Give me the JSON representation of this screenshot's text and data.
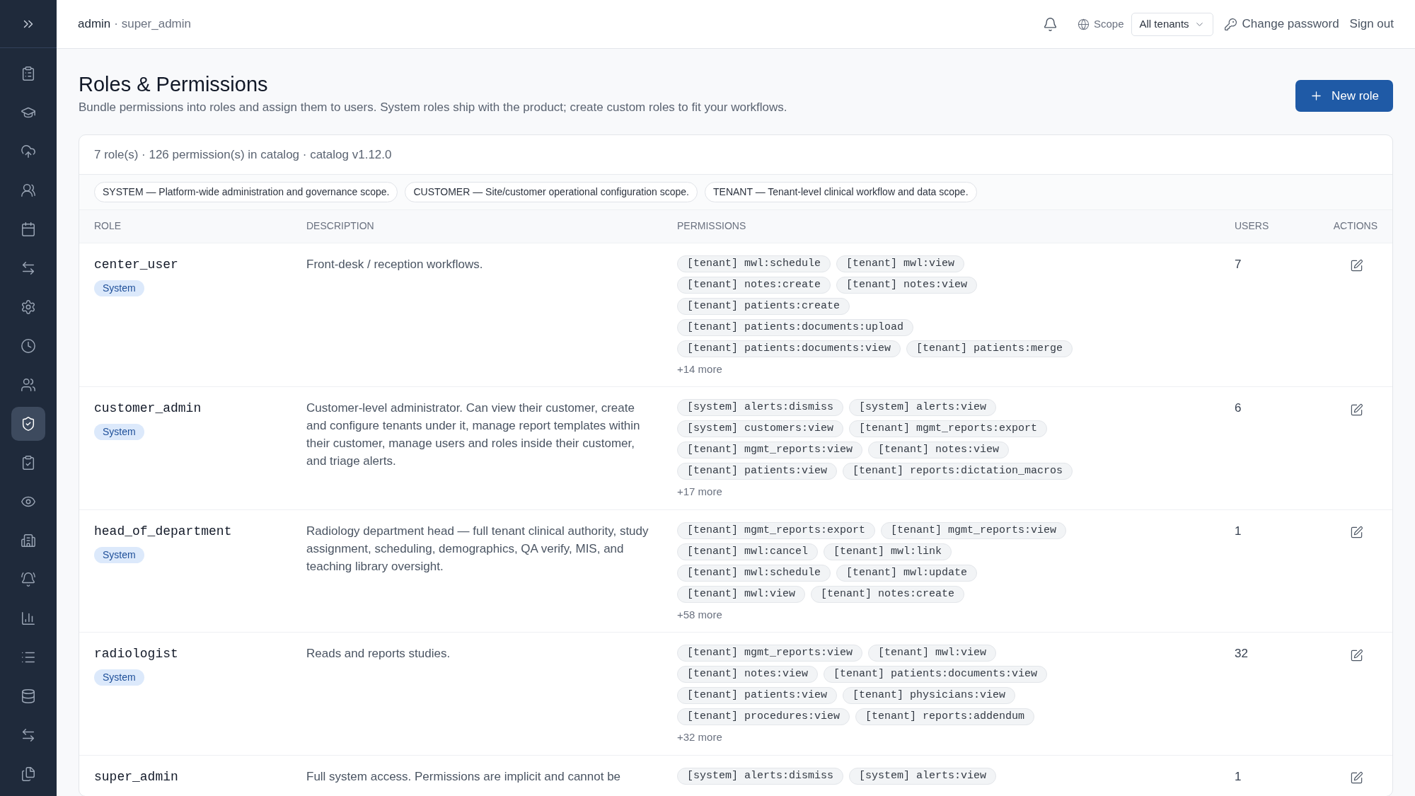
{
  "header": {
    "user": "admin",
    "role": "· super_admin",
    "scope_label": "Scope",
    "scope_value": "All tenants",
    "change_password": "Change password",
    "sign_out": "Sign out"
  },
  "sidebar": {
    "items": [
      {
        "selected": false
      },
      {
        "selected": false
      },
      {
        "selected": false
      },
      {
        "selected": false
      },
      {
        "selected": false
      },
      {
        "selected": false
      },
      {
        "selected": false
      },
      {
        "selected": false
      },
      {
        "selected": false
      },
      {
        "selected": true
      },
      {
        "selected": false
      },
      {
        "selected": false
      },
      {
        "selected": false
      },
      {
        "selected": false
      },
      {
        "selected": false
      },
      {
        "selected": false
      },
      {
        "selected": false
      },
      {
        "selected": false
      },
      {
        "selected": false
      }
    ]
  },
  "page": {
    "title": "Roles & Permissions",
    "subtitle": "Bundle permissions into roles and assign them to users. System roles ship with the product; create custom roles to fit your workflows.",
    "new_button": "New role"
  },
  "summary": "7 role(s) · 126 permission(s) in catalog · catalog v1.12.0",
  "scopes": [
    "SYSTEM — Platform-wide administration and governance scope.",
    "CUSTOMER — Site/customer operational configuration scope.",
    "TENANT — Tenant-level clinical workflow and data scope."
  ],
  "table": {
    "columns": [
      "ROLE",
      "DESCRIPTION",
      "PERMISSIONS",
      "USERS",
      "ACTIONS"
    ],
    "rows": [
      {
        "name": "center_user",
        "badge": "System",
        "description": "Front-desk / reception workflows.",
        "permission_lines": [
          [
            "[tenant] mwl:schedule",
            "[tenant] mwl:view"
          ],
          [
            "[tenant] notes:create",
            "[tenant] notes:view"
          ],
          [
            "[tenant] patients:create"
          ],
          [
            "[tenant] patients:documents:upload"
          ],
          [
            "[tenant] patients:documents:view",
            "[tenant] patients:merge"
          ]
        ],
        "more": "+14 more",
        "users": "7"
      },
      {
        "name": "customer_admin",
        "badge": "System",
        "description": "Customer-level administrator. Can view their customer, create and configure tenants under it, manage report templates within their customer, manage users and roles inside their customer, and triage alerts.",
        "permission_lines": [
          [
            "[system] alerts:dismiss",
            "[system] alerts:view"
          ],
          [
            "[system] customers:view",
            "[tenant] mgmt_reports:export"
          ],
          [
            "[tenant] mgmt_reports:view",
            "[tenant] notes:view"
          ],
          [
            "[tenant] patients:view",
            "[tenant] reports:dictation_macros"
          ]
        ],
        "more": "+17 more",
        "users": "6"
      },
      {
        "name": "head_of_department",
        "badge": "System",
        "description": "Radiology department head — full tenant clinical authority, study assignment, scheduling, demographics, QA verify, MIS, and teaching library oversight.",
        "permission_lines": [
          [
            "[tenant] mgmt_reports:export",
            "[tenant] mgmt_reports:view"
          ],
          [
            "[tenant] mwl:cancel",
            "[tenant] mwl:link"
          ],
          [
            "[tenant] mwl:schedule",
            "[tenant] mwl:update"
          ],
          [
            "[tenant] mwl:view",
            "[tenant] notes:create"
          ]
        ],
        "more": "+58 more",
        "users": "1"
      },
      {
        "name": "radiologist",
        "badge": "System",
        "description": "Reads and reports studies.",
        "permission_lines": [
          [
            "[tenant] mgmt_reports:view",
            "[tenant] mwl:view"
          ],
          [
            "[tenant] notes:view",
            "[tenant] patients:documents:view"
          ],
          [
            "[tenant] patients:view",
            "[tenant] physicians:view"
          ],
          [
            "[tenant] procedures:view",
            "[tenant] reports:addendum"
          ]
        ],
        "more": "+32 more",
        "users": "32"
      },
      {
        "name": "super_admin",
        "description": "Full system access. Permissions are implicit and cannot be",
        "permission_lines": [
          [
            "[system] alerts:dismiss",
            "[system] alerts:view"
          ]
        ],
        "users": "1"
      }
    ]
  }
}
